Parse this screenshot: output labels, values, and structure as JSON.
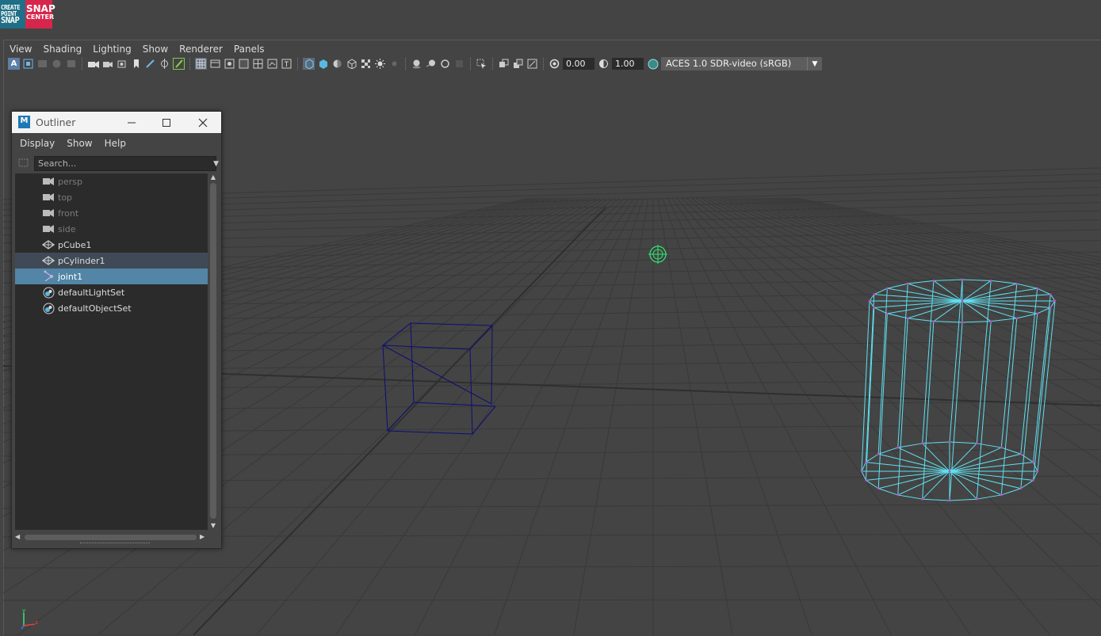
{
  "logo": {
    "left_lines": [
      "CREATE",
      "POINT",
      "SNAP"
    ],
    "right_lines": [
      "SNAP",
      "CENTER"
    ]
  },
  "panel_menu": [
    "View",
    "Shading",
    "Lighting",
    "Show",
    "Renderer",
    "Panels"
  ],
  "toolbar": {
    "exposure_value": "0.00",
    "gamma_value": "1.00",
    "color_space": "ACES 1.0 SDR-video (sRGB)"
  },
  "outliner": {
    "title": "Outliner",
    "menu": [
      "Display",
      "Show",
      "Help"
    ],
    "search_placeholder": "Search...",
    "items": [
      {
        "label": "persp",
        "icon": "camera-icon",
        "state": "dim"
      },
      {
        "label": "top",
        "icon": "camera-icon",
        "state": "dim"
      },
      {
        "label": "front",
        "icon": "camera-icon",
        "state": "dim"
      },
      {
        "label": "side",
        "icon": "camera-icon",
        "state": "dim"
      },
      {
        "label": "pCube1",
        "icon": "mesh-icon",
        "state": "normal"
      },
      {
        "label": "pCylinder1",
        "icon": "mesh-icon",
        "state": "highlighted"
      },
      {
        "label": "joint1",
        "icon": "joint-icon",
        "state": "selected"
      },
      {
        "label": "defaultLightSet",
        "icon": "set-icon",
        "state": "normal"
      },
      {
        "label": "defaultObjectSet",
        "icon": "set-icon",
        "state": "normal"
      }
    ]
  },
  "colors": {
    "viewport_bg": "#444444",
    "grid_line": "#393939",
    "cube_wire": "#0c0c78",
    "cylinder_wire": "#5ee0f0",
    "vertex": "#d040d0",
    "selection": "#5285a6",
    "joint": "#2ee872"
  }
}
